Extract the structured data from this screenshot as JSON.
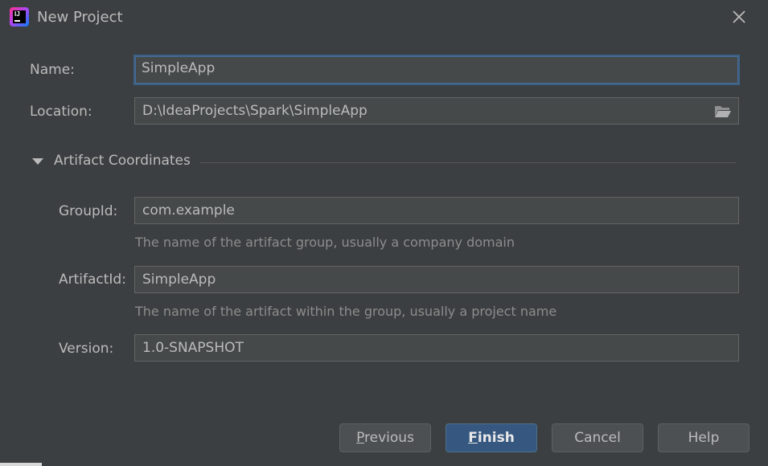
{
  "window": {
    "title": "New Project",
    "app_icon_text": "IJ"
  },
  "form": {
    "name_label": "Name:",
    "name_value": "SimpleApp",
    "location_label": "Location:",
    "location_value": "D:\\IdeaProjects\\Spark\\SimpleApp"
  },
  "artifact": {
    "section_title": "Artifact Coordinates",
    "expanded": true,
    "group_label": "GroupId:",
    "group_value": "com.example",
    "group_hint": "The name of the artifact group, usually a company domain",
    "artifact_label": "ArtifactId:",
    "artifact_value": "SimpleApp",
    "artifact_hint": "The name of the artifact within the group, usually a project name",
    "version_label": "Version:",
    "version_value": "1.0-SNAPSHOT"
  },
  "buttons": {
    "previous_first": "P",
    "previous_rest": "revious",
    "finish_first": "F",
    "finish_rest": "inish",
    "cancel": "Cancel",
    "help": "Help"
  },
  "colors": {
    "background": "#3c3f41",
    "field_background": "#45494a",
    "focus_border": "#3d6185",
    "primary_button": "#365880",
    "text": "#bbbbbb",
    "hint_text": "#8c8c8c"
  },
  "icons": {
    "app": "intellij-idea-icon",
    "close": "close-icon",
    "browse": "folder-open-icon",
    "collapse": "triangle-down-icon"
  }
}
